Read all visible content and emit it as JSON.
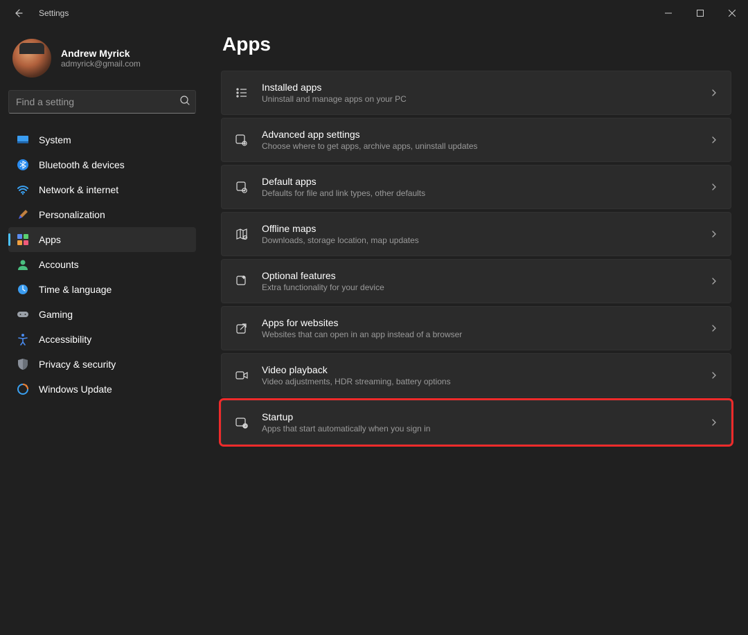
{
  "window": {
    "title": "Settings"
  },
  "profile": {
    "name": "Andrew Myrick",
    "email": "admyrick@gmail.com"
  },
  "search": {
    "placeholder": "Find a setting"
  },
  "sidebar": {
    "items": [
      {
        "label": "System"
      },
      {
        "label": "Bluetooth & devices"
      },
      {
        "label": "Network & internet"
      },
      {
        "label": "Personalization"
      },
      {
        "label": "Apps"
      },
      {
        "label": "Accounts"
      },
      {
        "label": "Time & language"
      },
      {
        "label": "Gaming"
      },
      {
        "label": "Accessibility"
      },
      {
        "label": "Privacy & security"
      },
      {
        "label": "Windows Update"
      }
    ]
  },
  "page": {
    "title": "Apps"
  },
  "cards": [
    {
      "title": "Installed apps",
      "desc": "Uninstall and manage apps on your PC"
    },
    {
      "title": "Advanced app settings",
      "desc": "Choose where to get apps, archive apps, uninstall updates"
    },
    {
      "title": "Default apps",
      "desc": "Defaults for file and link types, other defaults"
    },
    {
      "title": "Offline maps",
      "desc": "Downloads, storage location, map updates"
    },
    {
      "title": "Optional features",
      "desc": "Extra functionality for your device"
    },
    {
      "title": "Apps for websites",
      "desc": "Websites that can open in an app instead of a browser"
    },
    {
      "title": "Video playback",
      "desc": "Video adjustments, HDR streaming, battery options"
    },
    {
      "title": "Startup",
      "desc": "Apps that start automatically when you sign in"
    }
  ],
  "highlighted_card_index": 7,
  "active_sidebar_index": 4
}
